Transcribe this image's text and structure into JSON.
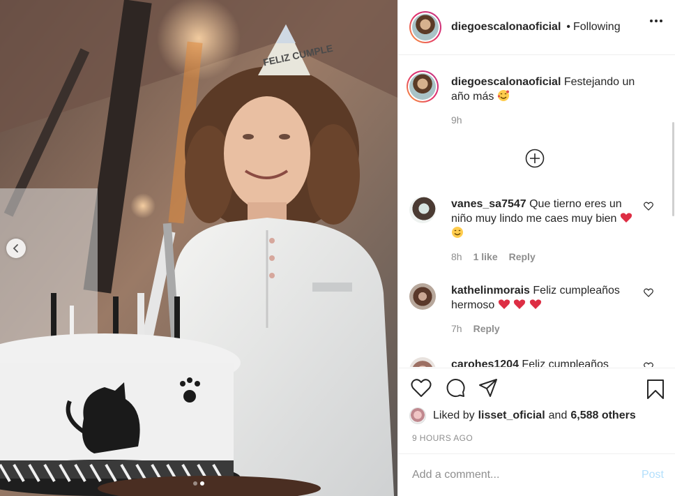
{
  "post": {
    "username": "diegoescalonaoficial",
    "separator": "•",
    "follow_status": "Following",
    "more_icon": "more-horizontal-icon"
  },
  "caption": {
    "username": "diegoescalonaoficial",
    "text": "Festejando un año más",
    "emoji": "smiling-face-with-hearts",
    "time": "9h"
  },
  "load_more_icon": "plus-circle-icon",
  "comments": [
    {
      "username": "vanes_sa7547",
      "text": "Que tierno eres un niño muy lindo me caes muy bien",
      "emojis": [
        "red-heart",
        "smiling-face"
      ],
      "time": "8h",
      "likes": "1 like",
      "reply": "Reply"
    },
    {
      "username": "kathelinmorais",
      "text": "Feliz cumpleaños hermoso",
      "emojis": [
        "red-heart",
        "red-heart",
        "red-heart"
      ],
      "time": "7h",
      "likes": "",
      "reply": "Reply"
    },
    {
      "username": "carohes1204",
      "text": "Feliz cumpleaños",
      "emojis": [],
      "time": "",
      "likes": "",
      "reply": ""
    }
  ],
  "photo": {
    "hat_text": "FELIZ CUMPLE",
    "carousel_count": 2,
    "carousel_active": 2
  },
  "actions": {
    "like_icon": "heart-icon",
    "comment_icon": "comment-icon",
    "share_icon": "send-icon",
    "save_icon": "bookmark-icon"
  },
  "likes": {
    "prefix": "Liked by",
    "user": "lisset_oficial",
    "conj": "and",
    "others": "6,588 others"
  },
  "timestamp": "9 HOURS AGO",
  "add_comment": {
    "placeholder": "Add a comment...",
    "post_label": "Post"
  },
  "colors": {
    "text": "#262626",
    "muted": "#8e8e8e",
    "post_disabled": "#b2dffc",
    "heart_red": "#ed4956"
  }
}
